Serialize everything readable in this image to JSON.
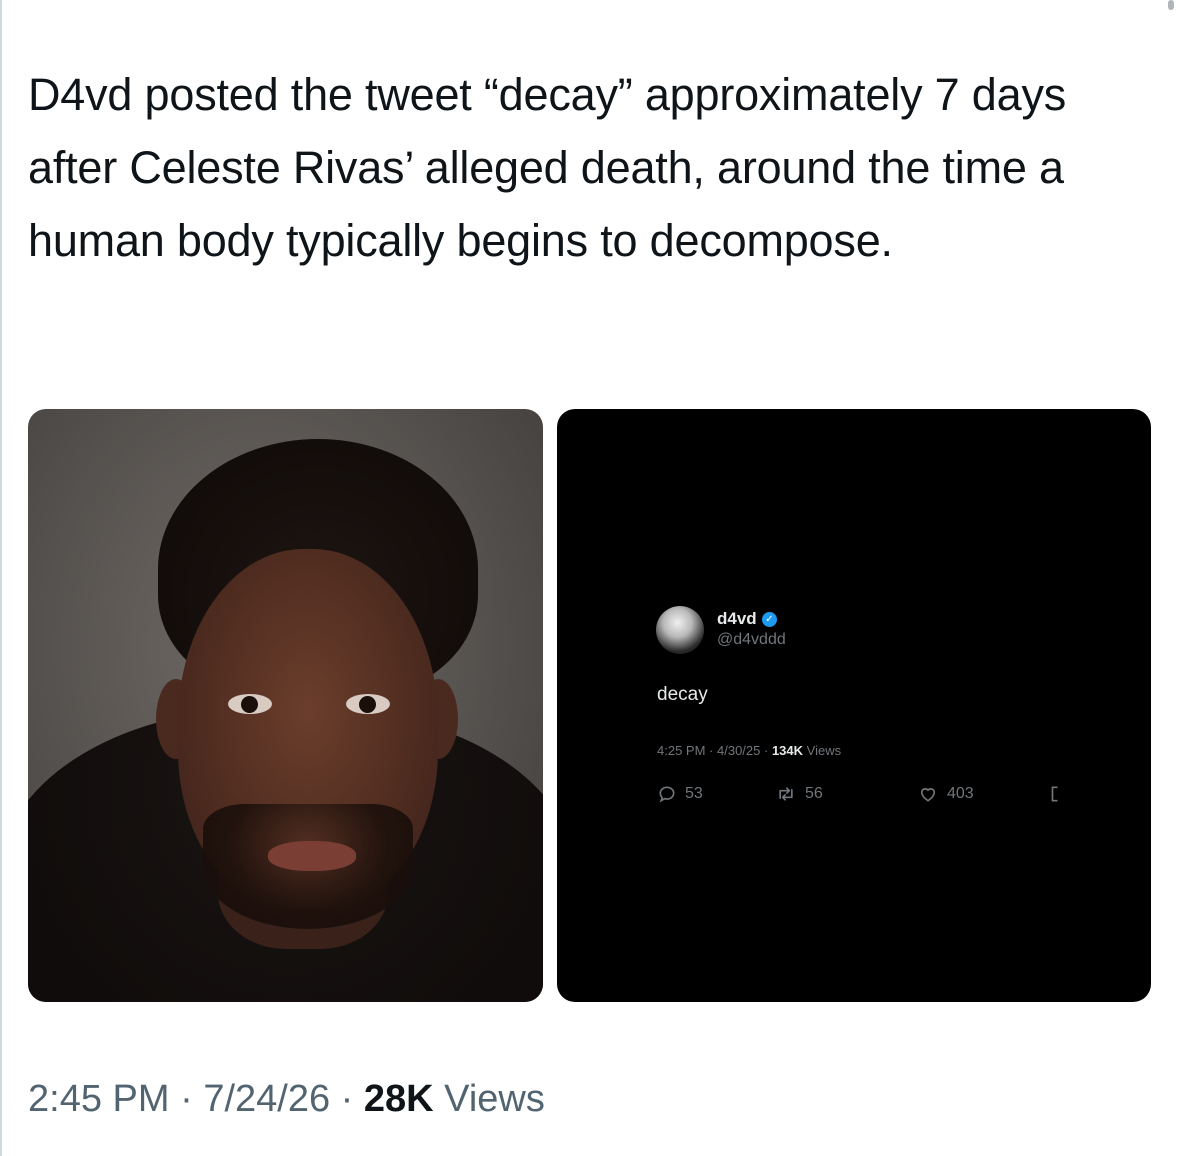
{
  "tweet": {
    "text": "D4vd posted the tweet “decay” approximately 7 days after Celeste Rivas’ alleged death, around the time a human body typically begins to decompose.",
    "time": "2:45 PM",
    "separator": "·",
    "date": "7/24/26",
    "views_count": "28K",
    "views_label": "Views"
  },
  "embedded_tweet": {
    "display_name": "d4vd",
    "handle": "@d4vddd",
    "text": "decay",
    "time": "4:25 PM",
    "date": "4/30/25",
    "views_count": "134K",
    "views_label": "Views",
    "replies": "53",
    "reposts": "56",
    "likes": "403",
    "verified_color": "#1d9bf0"
  },
  "icons": {
    "reply": "reply-icon",
    "repost": "repost-icon",
    "like": "heart-icon",
    "bookmark": "bookmark-icon",
    "verified": "verified-badge-icon"
  }
}
